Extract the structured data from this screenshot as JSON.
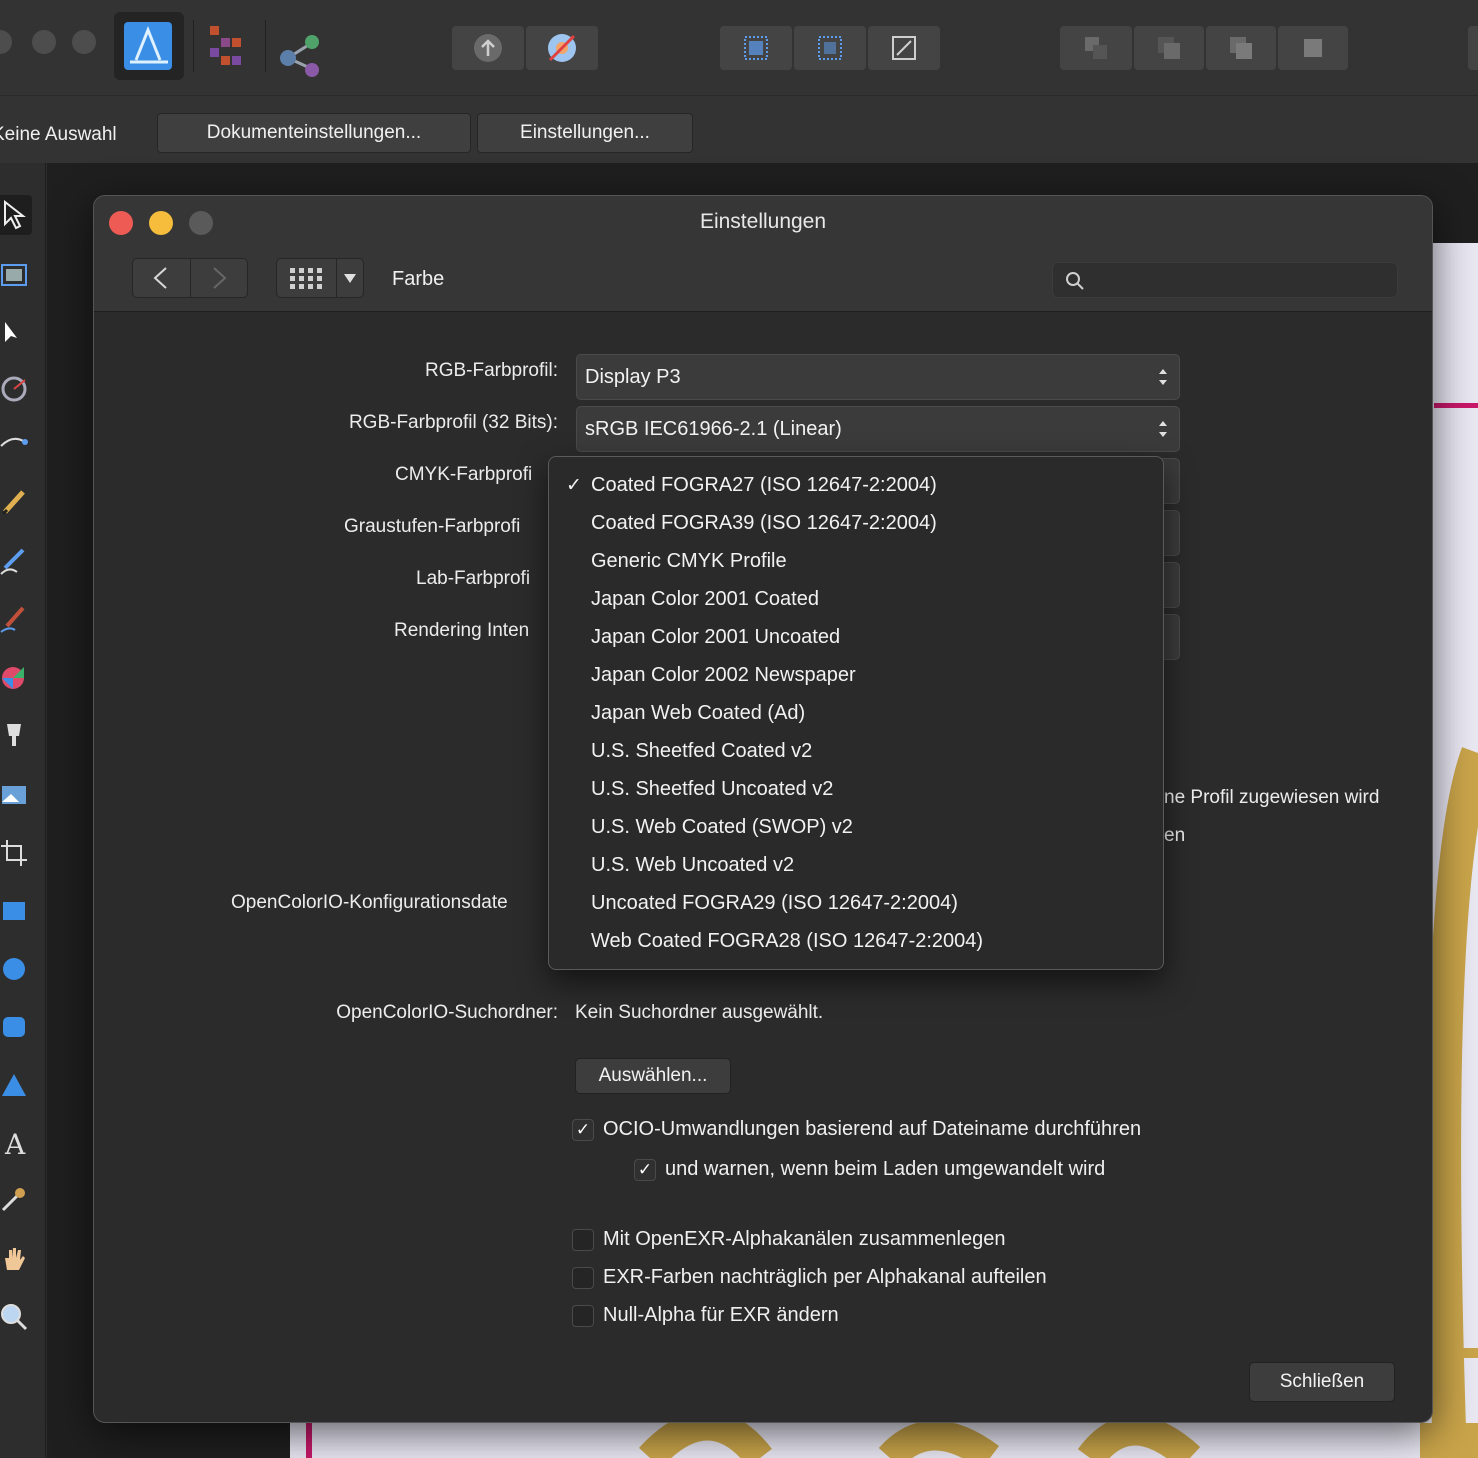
{
  "context_bar": {
    "selection_label": "Keine Auswahl",
    "doc_settings_button": "Dokumenteinstellungen...",
    "settings_button": "Einstellungen..."
  },
  "dialog": {
    "title": "Einstellungen",
    "section": "Farbe",
    "search_placeholder": "",
    "labels": {
      "rgb_profile": "RGB-Farbprofil:",
      "rgb_profile_32": "RGB-Farbprofil (32 Bits):",
      "cmyk_profile": "CMYK-Farbprofi",
      "gray_profile": "Graustufen-Farbprofi",
      "lab_profile": "Lab-Farbprofi",
      "rendering_intent": "Rendering Inten",
      "ocio_config": "OpenColorIO-Konfigurationsdate",
      "ocio_search": "OpenColorIO-Suchordner:"
    },
    "values": {
      "rgb_profile": "Display P3",
      "rgb_profile_32": "sRGB IEC61966-2.1 (Linear)",
      "ocio_search": "Kein Suchordner ausgewählt."
    },
    "partial_texts": {
      "profile_assigned": "ne Profil zugewiesen wird",
      "partial_en": "en"
    },
    "choose_button": "Auswählen...",
    "checkboxes": [
      {
        "label": "OCIO-Umwandlungen basierend auf Dateiname durchführen",
        "checked": true
      },
      {
        "label": "und warnen, wenn beim Laden umgewandelt wird",
        "checked": true
      },
      {
        "label": "Mit OpenEXR-Alphakanälen zusammenlegen",
        "checked": false
      },
      {
        "label": "EXR-Farben nachträglich per Alphakanal aufteilen",
        "checked": false
      },
      {
        "label": "Null-Alpha für EXR ändern",
        "checked": false
      }
    ],
    "close_button": "Schließen"
  },
  "cmyk_menu": {
    "check_mark": "✓",
    "items": [
      {
        "label": "Coated FOGRA27 (ISO 12647-2:2004)",
        "selected": true
      },
      {
        "label": "Coated FOGRA39 (ISO 12647-2:2004)",
        "selected": false
      },
      {
        "label": "Generic CMYK Profile",
        "selected": false
      },
      {
        "label": "Japan Color 2001 Coated",
        "selected": false
      },
      {
        "label": "Japan Color 2001 Uncoated",
        "selected": false
      },
      {
        "label": "Japan Color 2002 Newspaper",
        "selected": false
      },
      {
        "label": "Japan Web Coated (Ad)",
        "selected": false
      },
      {
        "label": "U.S. Sheetfed Coated v2",
        "selected": false
      },
      {
        "label": "U.S. Sheetfed Uncoated v2",
        "selected": false
      },
      {
        "label": "U.S. Web Coated (SWOP) v2",
        "selected": false
      },
      {
        "label": "U.S. Web Uncoated v2",
        "selected": false
      },
      {
        "label": "Uncoated FOGRA29 (ISO 12647-2:2004)",
        "selected": false
      },
      {
        "label": "Web Coated FOGRA28 (ISO 12647-2:2004)",
        "selected": false
      }
    ]
  },
  "colors": {
    "close_light": "#ee5b55",
    "minimize_light": "#f5bd3b",
    "zoom_light": "#5a5a5a",
    "accent_blue": "#3a8ee6",
    "doc_magenta": "#c8186a",
    "doc_gold": "#c9a44a"
  },
  "icons": {
    "designer_persona": "designer-persona-icon",
    "pixel_persona": "pixel-persona-icon",
    "export_persona": "export-persona-icon"
  }
}
